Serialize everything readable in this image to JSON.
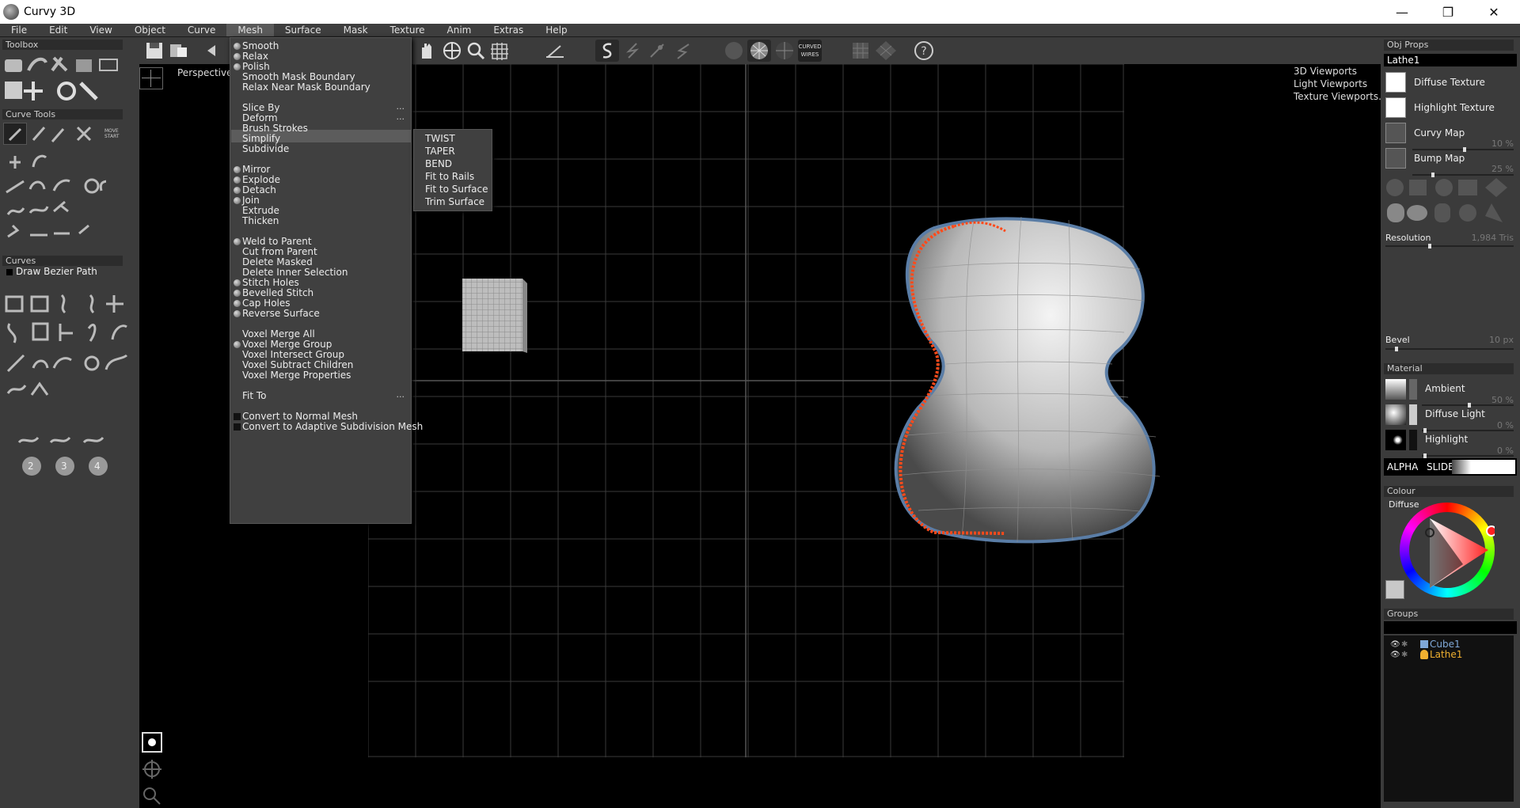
{
  "window": {
    "title": "Curvy 3D",
    "minimize": "—",
    "maximize": "❐",
    "close": "✕"
  },
  "menubar": [
    "File",
    "Edit",
    "View",
    "Object",
    "Curve",
    "Mesh",
    "Surface",
    "Mask",
    "Texture",
    "Anim",
    "Extras",
    "Help"
  ],
  "active_menu": "Mesh",
  "left_panel": {
    "toolbox": "Toolbox",
    "curve_tools": "Curve Tools",
    "curves": "Curves",
    "draw_bezier": "Draw Bezier Path",
    "move_start": "MOVE\nSTART",
    "numbered_tools": [
      "2",
      "3",
      "4"
    ]
  },
  "toolbar": {
    "curved_wires": "CURVED WIRES"
  },
  "viewport": {
    "label": "Perspective",
    "links": [
      "3D Viewports",
      "Light Viewports",
      "Texture Viewports..."
    ]
  },
  "mesh_menu": {
    "items": [
      {
        "label": "Smooth",
        "icon": "ball"
      },
      {
        "label": "Relax",
        "icon": "ball"
      },
      {
        "label": "Polish",
        "icon": "ball"
      },
      {
        "label": "Smooth Mask Boundary",
        "icon": ""
      },
      {
        "label": "Relax Near Mask Boundary",
        "icon": ""
      },
      {
        "label": "Slice By",
        "icon": "",
        "dots": "..."
      },
      {
        "label": "Deform",
        "icon": "",
        "dots": "..."
      },
      {
        "label": "Brush Strokes",
        "icon": ""
      },
      {
        "label": "Simplify",
        "icon": ""
      },
      {
        "label": "Subdivide",
        "icon": ""
      },
      {
        "label": "Mirror",
        "icon": "ball"
      },
      {
        "label": "Explode",
        "icon": "ball"
      },
      {
        "label": "Detach",
        "icon": "ball"
      },
      {
        "label": "Join",
        "icon": "ball"
      },
      {
        "label": "Extrude",
        "icon": ""
      },
      {
        "label": "Thicken",
        "icon": ""
      },
      {
        "label": "Weld to Parent",
        "icon": "ball"
      },
      {
        "label": "Cut from Parent",
        "icon": ""
      },
      {
        "label": "Delete Masked",
        "icon": ""
      },
      {
        "label": "Delete Inner Selection",
        "icon": ""
      },
      {
        "label": "Stitch Holes",
        "icon": "ball"
      },
      {
        "label": "Bevelled Stitch",
        "icon": "ball"
      },
      {
        "label": "Cap Holes",
        "icon": "ball"
      },
      {
        "label": "Reverse Surface",
        "icon": "ball"
      },
      {
        "label": "Voxel Merge All",
        "icon": ""
      },
      {
        "label": "Voxel Merge Group",
        "icon": "ball"
      },
      {
        "label": "Voxel Intersect Group",
        "icon": ""
      },
      {
        "label": "Voxel Subtract Children",
        "icon": ""
      },
      {
        "label": "Voxel Merge Properties",
        "icon": ""
      },
      {
        "label": "Fit To",
        "icon": "",
        "dots": "..."
      },
      {
        "label": "Convert to Normal Mesh",
        "icon": "square"
      },
      {
        "label": "Convert to Adaptive Subdivision Mesh",
        "icon": "square"
      }
    ]
  },
  "deform_submenu": [
    "TWIST",
    "TAPER",
    "BEND",
    "Fit to Rails",
    "Fit to Surface",
    "Trim Surface"
  ],
  "right_panel": {
    "obj_props": "Obj Props",
    "object_name": "Lathe1",
    "textures": [
      "Diffuse Texture",
      "Highlight Texture",
      "Curvy Map",
      "Bump Map"
    ],
    "curvy_map_val": "10 %",
    "bump_map_val": "25 %",
    "resolution": "Resolution",
    "resolution_val": "1,984 Tris",
    "bevel": "Bevel",
    "bevel_val": "10 px",
    "material": "Material",
    "ambient": "Ambient",
    "ambient_val": "50 %",
    "diffuse_light": "Diffuse Light",
    "diffuse_light_val": "0 %",
    "highlight": "Highlight",
    "highlight_val": "0 %",
    "alpha": "ALPHA",
    "slider": "SLIDER",
    "colour": "Colour",
    "diffuse": "Diffuse",
    "groups": "Groups",
    "group_items": [
      {
        "name": "Cube1",
        "color": "#7fa8d8"
      },
      {
        "name": "Lathe1",
        "color": "#f0b030"
      }
    ]
  },
  "colors": {
    "panel": "#3b3b3b",
    "outline": "#5a7da6",
    "curve": "#ff4a1a"
  }
}
